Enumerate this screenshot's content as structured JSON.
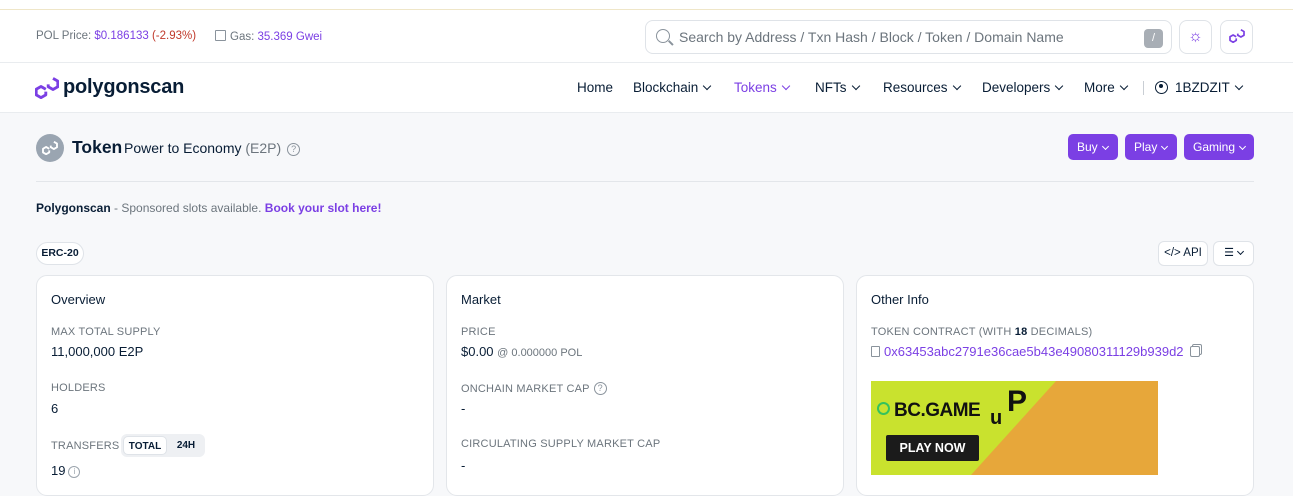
{
  "topbar": {
    "price_label": "POL Price:",
    "price_value": "$0.186133",
    "price_change": "(-2.93%)",
    "gas_label": "Gas:",
    "gas_value": "35.369 Gwei",
    "search_placeholder": "Search by Address / Txn Hash / Block / Token / Domain Name",
    "search_shortcut": "/"
  },
  "brand": {
    "name": "polygonscan",
    "accent": "#7b3fe4"
  },
  "nav": {
    "home": "Home",
    "blockchain": "Blockchain",
    "tokens": "Tokens",
    "nfts": "NFTs",
    "resources": "Resources",
    "developers": "Developers",
    "more": "More",
    "user": "1BZDZIT"
  },
  "token": {
    "heading": "Token",
    "name": "Power to Economy",
    "symbol": "(E2P)",
    "standard": "ERC-20"
  },
  "actions": {
    "buy": "Buy",
    "play": "Play",
    "gaming": "Gaming",
    "api": "</> API"
  },
  "sponsor": {
    "brand": "Polygonscan",
    "text": " - Sponsored slots available. ",
    "link": "Book your slot here!"
  },
  "overview": {
    "title": "Overview",
    "max_supply_label": "MAX TOTAL SUPPLY",
    "max_supply_value": "11,000,000 E2P",
    "holders_label": "HOLDERS",
    "holders_value": "6",
    "transfers_label": "TRANSFERS",
    "toggle_total": "TOTAL",
    "toggle_24h": "24H",
    "transfers_value": "19"
  },
  "market": {
    "title": "Market",
    "price_label": "PRICE",
    "price_value": "$0.00",
    "price_pol": "@ 0.000000 POL",
    "onchain_label": "ONCHAIN MARKET CAP",
    "onchain_value": "-",
    "circ_label": "CIRCULATING SUPPLY MARKET CAP",
    "circ_value": "-"
  },
  "other_info": {
    "title": "Other Info",
    "contract_label_pre": "TOKEN CONTRACT (WITH ",
    "decimals": "18",
    "contract_label_post": " DECIMALS)",
    "contract_address": "0x63453abc2791e36cae5b43e49080311129b939d2"
  },
  "ad": {
    "brand": "BC.GAME",
    "u": "u",
    "p": "P",
    "cta": "PLAY NOW"
  }
}
